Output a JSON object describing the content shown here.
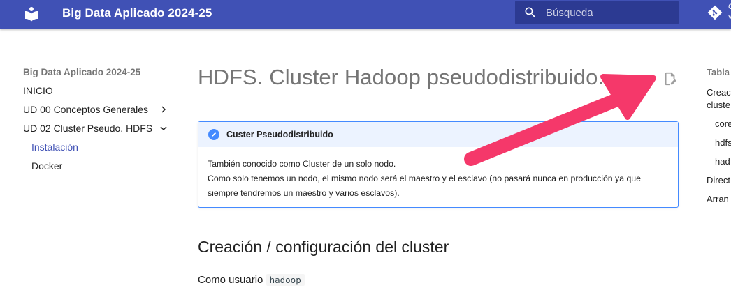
{
  "header": {
    "site_title": "Big Data Aplicado 2024-25",
    "search_placeholder": "Búsqueda",
    "repo_text": "G\nv",
    "colors": {
      "primary": "#4051b5",
      "search_bg": "#2c3a92"
    },
    "icons": [
      "book-logo-icon",
      "search-icon",
      "git-icon"
    ]
  },
  "nav": {
    "title": "Big Data Aplicado 2024-25",
    "items": [
      {
        "label": "INICIO"
      },
      {
        "label": "UD 00 Conceptos Generales",
        "chevron": "right"
      },
      {
        "label": "UD 02 Cluster Pseudo. HDFS",
        "chevron": "down"
      },
      {
        "label": "Instalación",
        "active": true
      },
      {
        "label": "Docker"
      }
    ]
  },
  "main": {
    "page_title": "HDFS. Cluster Hadoop pseudodistribuido.",
    "admonition": {
      "title": "Custer Pseudodistribuido",
      "lines": [
        "También conocido como Cluster de un solo nodo.",
        "Como solo tenemos un nodo, el mismo nodo será el maestro y el esclavo (no pasará nunca en producción ya que",
        "siempre tendremos un maestro y varios esclavos)."
      ]
    },
    "section_title": "Creación / configuración del cluster",
    "paragraph_prefix": "Como usuario",
    "paragraph_code": "hadoop"
  },
  "toc": {
    "title": "Tabla",
    "items": [
      "Creac",
      "cluste",
      "core",
      "hdfs",
      "had",
      "Direct",
      "Arran"
    ]
  },
  "annotation": {
    "arrow_color": "#f5386a"
  }
}
